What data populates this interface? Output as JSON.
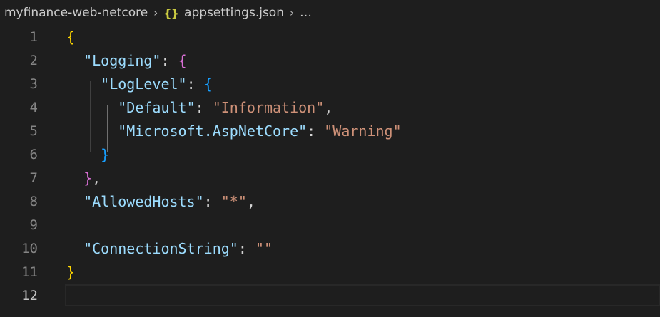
{
  "breadcrumb": {
    "folder": "myfinance-web-netcore",
    "file_icon": "{}",
    "file": "appsettings.json",
    "more": "…",
    "separator_icon": "chevron-right-icon"
  },
  "editor": {
    "lines": [
      {
        "number": "1",
        "indent": "",
        "tokens": [
          {
            "t": "{",
            "c": "b1"
          }
        ]
      },
      {
        "number": "2",
        "indent": "  ",
        "tokens": [
          {
            "t": "\"Logging\"",
            "c": "key"
          },
          {
            "t": ": ",
            "c": "punct"
          },
          {
            "t": "{",
            "c": "b2"
          }
        ]
      },
      {
        "number": "3",
        "indent": "    ",
        "tokens": [
          {
            "t": "\"LogLevel\"",
            "c": "key"
          },
          {
            "t": ": ",
            "c": "punct"
          },
          {
            "t": "{",
            "c": "b3"
          }
        ]
      },
      {
        "number": "4",
        "indent": "      ",
        "tokens": [
          {
            "t": "\"Default\"",
            "c": "key"
          },
          {
            "t": ": ",
            "c": "punct"
          },
          {
            "t": "\"Information\"",
            "c": "str"
          },
          {
            "t": ",",
            "c": "punct"
          }
        ]
      },
      {
        "number": "5",
        "indent": "      ",
        "tokens": [
          {
            "t": "\"Microsoft.AspNetCore\"",
            "c": "key"
          },
          {
            "t": ": ",
            "c": "punct"
          },
          {
            "t": "\"Warning\"",
            "c": "str"
          }
        ]
      },
      {
        "number": "6",
        "indent": "    ",
        "tokens": [
          {
            "t": "}",
            "c": "b3"
          }
        ]
      },
      {
        "number": "7",
        "indent": "  ",
        "tokens": [
          {
            "t": "}",
            "c": "b2"
          },
          {
            "t": ",",
            "c": "punct"
          }
        ]
      },
      {
        "number": "8",
        "indent": "  ",
        "tokens": [
          {
            "t": "\"AllowedHosts\"",
            "c": "key"
          },
          {
            "t": ": ",
            "c": "punct"
          },
          {
            "t": "\"*\"",
            "c": "str"
          },
          {
            "t": ",",
            "c": "punct"
          }
        ]
      },
      {
        "number": "9",
        "indent": "",
        "tokens": []
      },
      {
        "number": "10",
        "indent": "  ",
        "tokens": [
          {
            "t": "\"ConnectionString\"",
            "c": "key"
          },
          {
            "t": ": ",
            "c": "punct"
          },
          {
            "t": "\"\"",
            "c": "str"
          }
        ]
      },
      {
        "number": "11",
        "indent": "",
        "tokens": [
          {
            "t": "}",
            "c": "b1"
          }
        ]
      },
      {
        "number": "12",
        "indent": "",
        "tokens": []
      }
    ],
    "active_line": "12"
  },
  "colors": {
    "background": "#1e1e1e",
    "key": "#9cdcfe",
    "string": "#ce9178",
    "bracket_level1": "#ffd700",
    "bracket_level2": "#da70d6",
    "bracket_level3": "#179fff",
    "line_number": "#858585"
  }
}
